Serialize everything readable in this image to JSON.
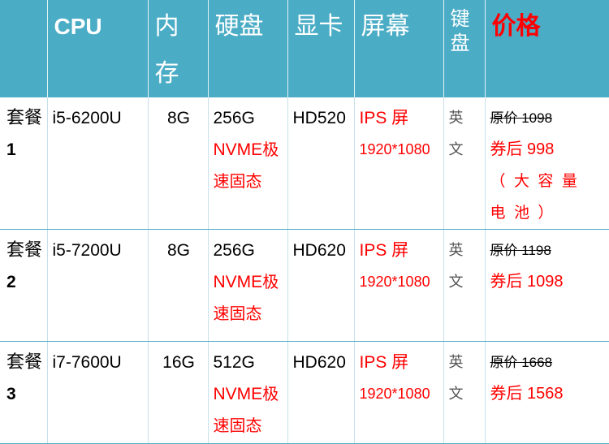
{
  "headers": {
    "package": "",
    "cpu": "CPU",
    "memory_line1": "内",
    "memory_line2": "存",
    "disk": "硬盘",
    "gpu": "显卡",
    "screen": "屏幕",
    "keyboard_line1": "键",
    "keyboard_line2": "盘",
    "price": "价格"
  },
  "rows": [
    {
      "package_text": "套餐",
      "package_num": "1",
      "cpu": "i5-6200U",
      "memory": "8G",
      "disk_size": "256G",
      "disk_type": "NVME",
      "disk_speed_a": "极",
      "disk_speed_b": "速固态",
      "gpu": "HD520",
      "screen_type": "IPS 屏",
      "screen_res": "1920*1080",
      "keyboard_a": "英",
      "keyboard_b": "文",
      "price_original": "原价 1098",
      "price_deal": "券后 998",
      "price_note": "（大容量电池）"
    },
    {
      "package_text": "套餐",
      "package_num": "2",
      "cpu": "i5-7200U",
      "memory": "8G",
      "disk_size": "256G",
      "disk_type": "NVME",
      "disk_speed_a": "极",
      "disk_speed_b": "速固态",
      "gpu": "HD620",
      "screen_type": "IPS 屏",
      "screen_res": "1920*1080",
      "keyboard_a": "英",
      "keyboard_b": "文",
      "price_original": "原价 1198",
      "price_deal": "券后 1098",
      "price_note": ""
    },
    {
      "package_text": "套餐",
      "package_num": "3",
      "cpu": "i7-7600U",
      "memory": "16G",
      "disk_size": "512G",
      "disk_type": "NVME",
      "disk_speed_a": "极",
      "disk_speed_b": "速固态",
      "gpu": "HD620",
      "screen_type": "IPS 屏",
      "screen_res": "1920*1080",
      "keyboard_a": "英",
      "keyboard_b": "文",
      "price_original": "原价 1668",
      "price_deal": "券后 1568",
      "price_note": ""
    }
  ],
  "colors": {
    "header_bg": "#4bacc6",
    "header_text": "#ffffff",
    "accent_red": "#ff0000"
  }
}
